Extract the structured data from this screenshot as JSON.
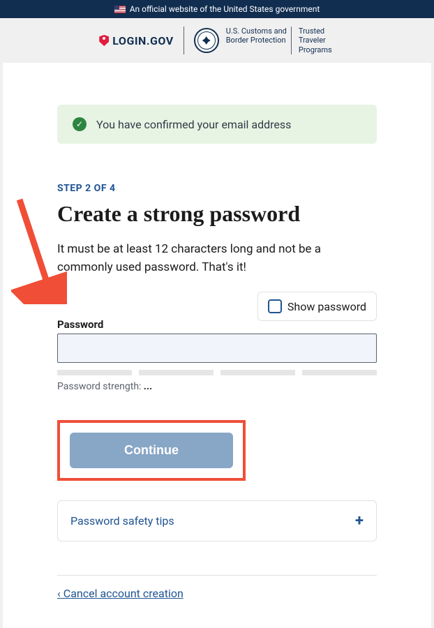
{
  "banner": {
    "text": "An official website of the United States government"
  },
  "header": {
    "login_brand": "LOGIN.GOV",
    "partner_line1a": "U.S. Customs and",
    "partner_line1b": "Border Protection",
    "partner_line2a": "Trusted",
    "partner_line2b": "Traveler",
    "partner_line2c": "Programs"
  },
  "alert": {
    "text": "You have confirmed your email address"
  },
  "step": "STEP 2 OF 4",
  "heading": "Create a strong password",
  "description": "It must be at least 12 characters long and not be a commonly used password. That's it!",
  "show_password_label": "Show password",
  "password_label": "Password",
  "password_value": "",
  "strength_label": "Password strength: ",
  "strength_value": "...",
  "continue_label": "Continue",
  "accordion_title": "Password safety tips",
  "cancel_link": "‹ Cancel account creation"
}
